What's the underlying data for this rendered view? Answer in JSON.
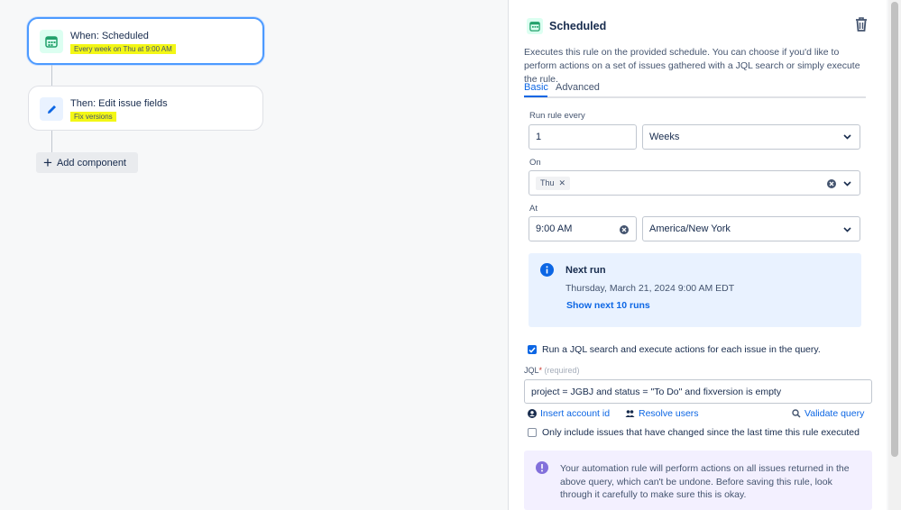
{
  "canvas": {
    "trigger": {
      "title": "When: Scheduled",
      "subtitle": "Every week on Thu at 9:00 AM",
      "icon": "calendar-icon",
      "color": "#22a06b"
    },
    "action": {
      "title": "Then: Edit issue fields",
      "subtitle": "Fix versions",
      "icon": "pencil-icon",
      "color": "#0c66e4"
    },
    "add_component_label": "Add component"
  },
  "panel": {
    "title": "Scheduled",
    "description": "Executes this rule on the provided schedule. You can choose if you'd like to perform actions on a set of issues gathered with a JQL search or simply execute the rule.",
    "tabs": [
      {
        "label": "Basic",
        "active": true
      },
      {
        "label": "Advanced",
        "active": false
      }
    ],
    "run_rule_every_label": "Run rule every",
    "interval_value": "1",
    "interval_unit": "Weeks",
    "on_label": "On",
    "on_tag": "Thu",
    "at_label": "At",
    "time_value": "9:00 AM",
    "timezone": "America/New York",
    "next_run": {
      "title": "Next run",
      "date": "Thursday, March 21, 2024 9:00 AM EDT",
      "show_next_label": "Show next 10 runs"
    },
    "jql_checkbox_label": "Run a JQL search and execute actions for each issue in the query.",
    "jql_label": "JQL",
    "jql_required": "* ",
    "jql_required_hint": "(required)",
    "jql_value": "project = JGBJ and status = \"To Do\" and fixversion is empty",
    "insert_account_label": "Insert account id",
    "resolve_users_label": "Resolve users",
    "validate_query_label": "Validate query",
    "only_changed_label": "Only include issues that have changed since the last time this rule executed",
    "warning_text": "Your automation rule will perform actions on all issues returned in the above query, which can't be undone. Before saving this rule, look through it carefully to make sure this is okay.",
    "accent": "#0c66e4",
    "info_bg": "#e9f2ff",
    "warning_bg": "#f3f0ff"
  }
}
